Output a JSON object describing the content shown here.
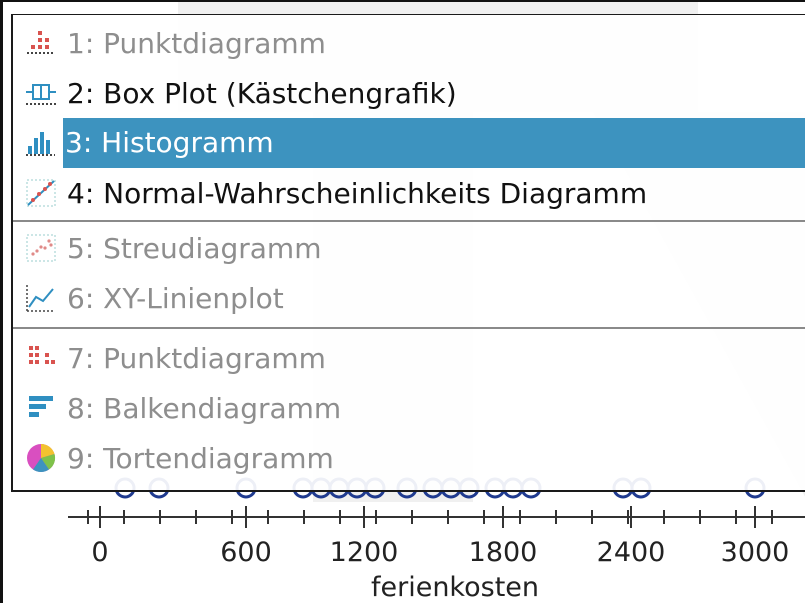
{
  "menu": {
    "items": [
      {
        "num": "1:",
        "label": "1: Punktdiagramm",
        "icon": "dot-plot-icon",
        "state": "disabled"
      },
      {
        "num": "2:",
        "label": "2: Box Plot (Kästchengrafik)",
        "icon": "box-plot-icon",
        "state": "enabled"
      },
      {
        "num": "3:",
        "label": "3: Histogramm",
        "icon": "histogram-icon",
        "state": "selected"
      },
      {
        "num": "4:",
        "label": "4: Normal-Wahrscheinlichkeits Diagramm",
        "icon": "normal-probability-icon",
        "state": "enabled"
      },
      {
        "num": "5:",
        "label": "5: Streudiagramm",
        "icon": "scatter-plot-icon",
        "state": "disabled"
      },
      {
        "num": "6:",
        "label": "6: XY-Linienplot",
        "icon": "xy-line-plot-icon",
        "state": "disabled"
      },
      {
        "num": "7:",
        "label": "7: Punktdiagramm",
        "icon": "categorical-dot-plot-icon",
        "state": "disabled"
      },
      {
        "num": "8:",
        "label": "8: Balkendiagramm",
        "icon": "bar-chart-icon",
        "state": "disabled"
      },
      {
        "num": "9:",
        "label": "9: Tortendiagramm",
        "icon": "pie-chart-icon",
        "state": "disabled"
      }
    ]
  },
  "plot": {
    "x_ticks": [
      "0",
      "600",
      "1200",
      "1800",
      "2400",
      "3000"
    ],
    "x_label": "ferienkosten"
  },
  "colors": {
    "selection": "#3d93bf",
    "dot": "#1f3a8f",
    "disabled_text": "#8e8e8e"
  }
}
